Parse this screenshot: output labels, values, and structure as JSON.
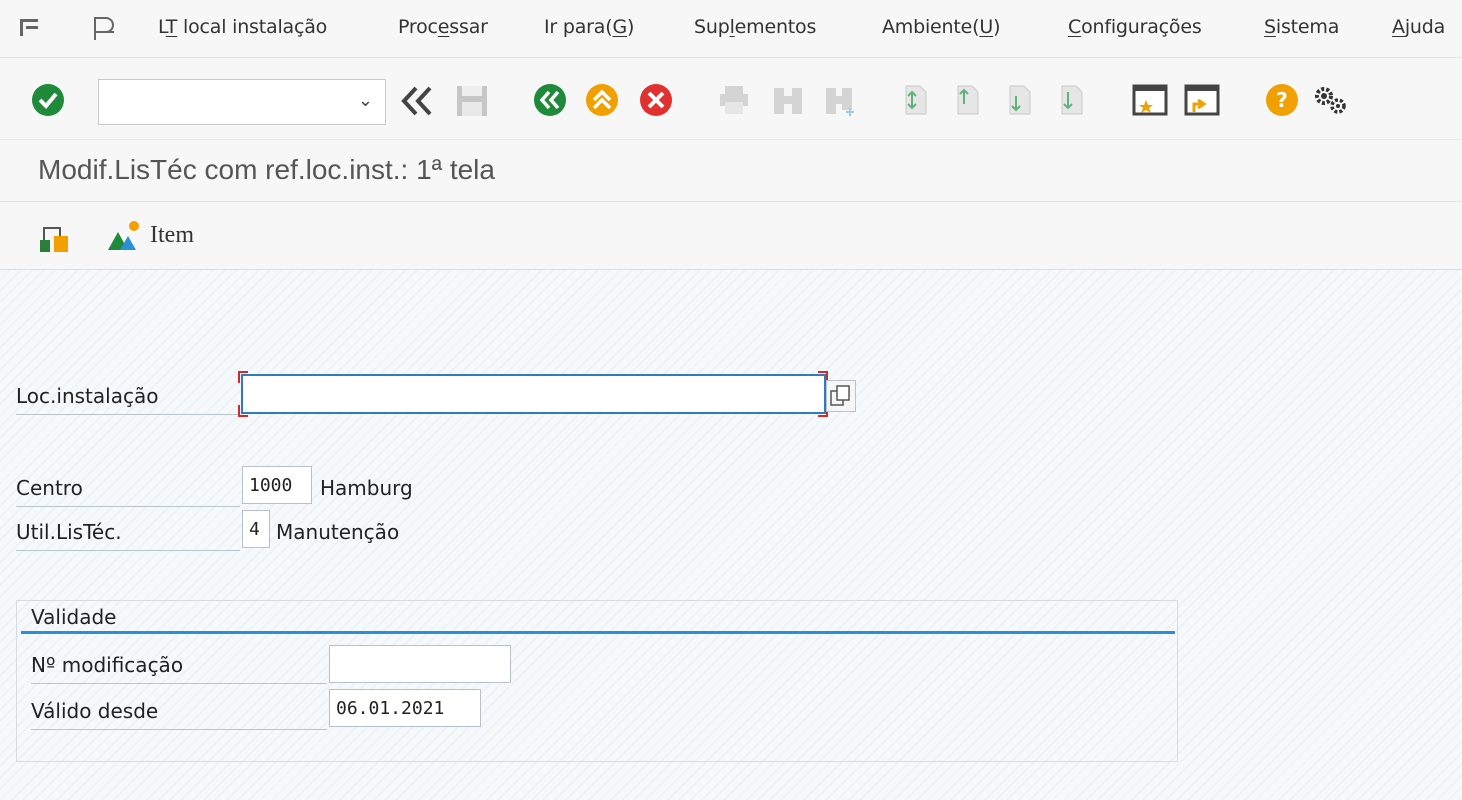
{
  "menubar": {
    "items": [
      {
        "label": "LT local instalação",
        "mnemonic": "T"
      },
      {
        "label": "Processar",
        "mnemonic": "e"
      },
      {
        "label": "Ir para(G)",
        "mnemonic": "G"
      },
      {
        "label": "Suplementos",
        "mnemonic": "l"
      },
      {
        "label": "Ambiente(U)",
        "mnemonic": "U"
      },
      {
        "label": "Configurações",
        "mnemonic": "C"
      },
      {
        "label": "Sistema",
        "mnemonic": "S"
      },
      {
        "label": "Ajuda",
        "mnemonic": "A"
      }
    ]
  },
  "toolbar": {
    "command_field_value": "",
    "colors": {
      "enter": "#1f8a3a",
      "back": "#1f8a3a",
      "exit": "#f0a000",
      "cancel": "#e03030",
      "help": "#f0a000"
    }
  },
  "title": "Modif.LisTéc com ref.loc.inst.: 1ª tela",
  "apptoolbar": {
    "item_label": "Item"
  },
  "form": {
    "loc_label": "Loc.instalação",
    "loc_value": "",
    "centro_label": "Centro",
    "centro_value": "1000",
    "centro_desc": "Hamburg",
    "util_label": "Util.LisTéc.",
    "util_value": "4",
    "util_desc": "Manutenção"
  },
  "validity": {
    "title": "Validade",
    "mod_label": "Nº modificação",
    "mod_value": "",
    "date_label": "Válido desde",
    "date_value": "06.01.2021"
  }
}
